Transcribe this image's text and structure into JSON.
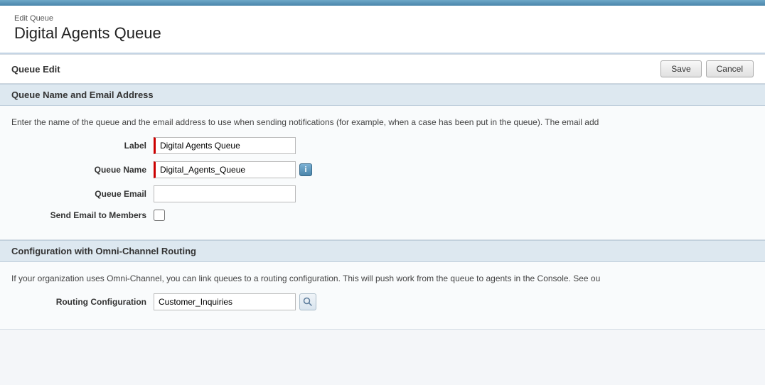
{
  "topBar": {},
  "header": {
    "editQueueLabel": "Edit Queue",
    "pageTitle": "Digital Agents Queue"
  },
  "queueEdit": {
    "sectionTitle": "Queue Edit",
    "saveLabel": "Save",
    "cancelLabel": "Cancel"
  },
  "queueNameSection": {
    "title": "Queue Name and Email Address",
    "description": "Enter the name of the queue and the email address to use when sending notifications (for example, when a case has been put in the queue). The email add",
    "labelField": {
      "label": "Label",
      "value": "Digital Agents Queue"
    },
    "queueNameField": {
      "label": "Queue Name",
      "value": "Digital_Agents_Queue"
    },
    "queueEmailField": {
      "label": "Queue Email",
      "value": ""
    },
    "sendEmailField": {
      "label": "Send Email to Members"
    }
  },
  "omniChannelSection": {
    "title": "Configuration with Omni-Channel Routing",
    "description": "If your organization uses Omni-Channel, you can link queues to a routing configuration. This will push work from the queue to agents in the Console. See ou",
    "routingConfigField": {
      "label": "Routing Configuration",
      "value": "Customer_Inquiries"
    }
  }
}
